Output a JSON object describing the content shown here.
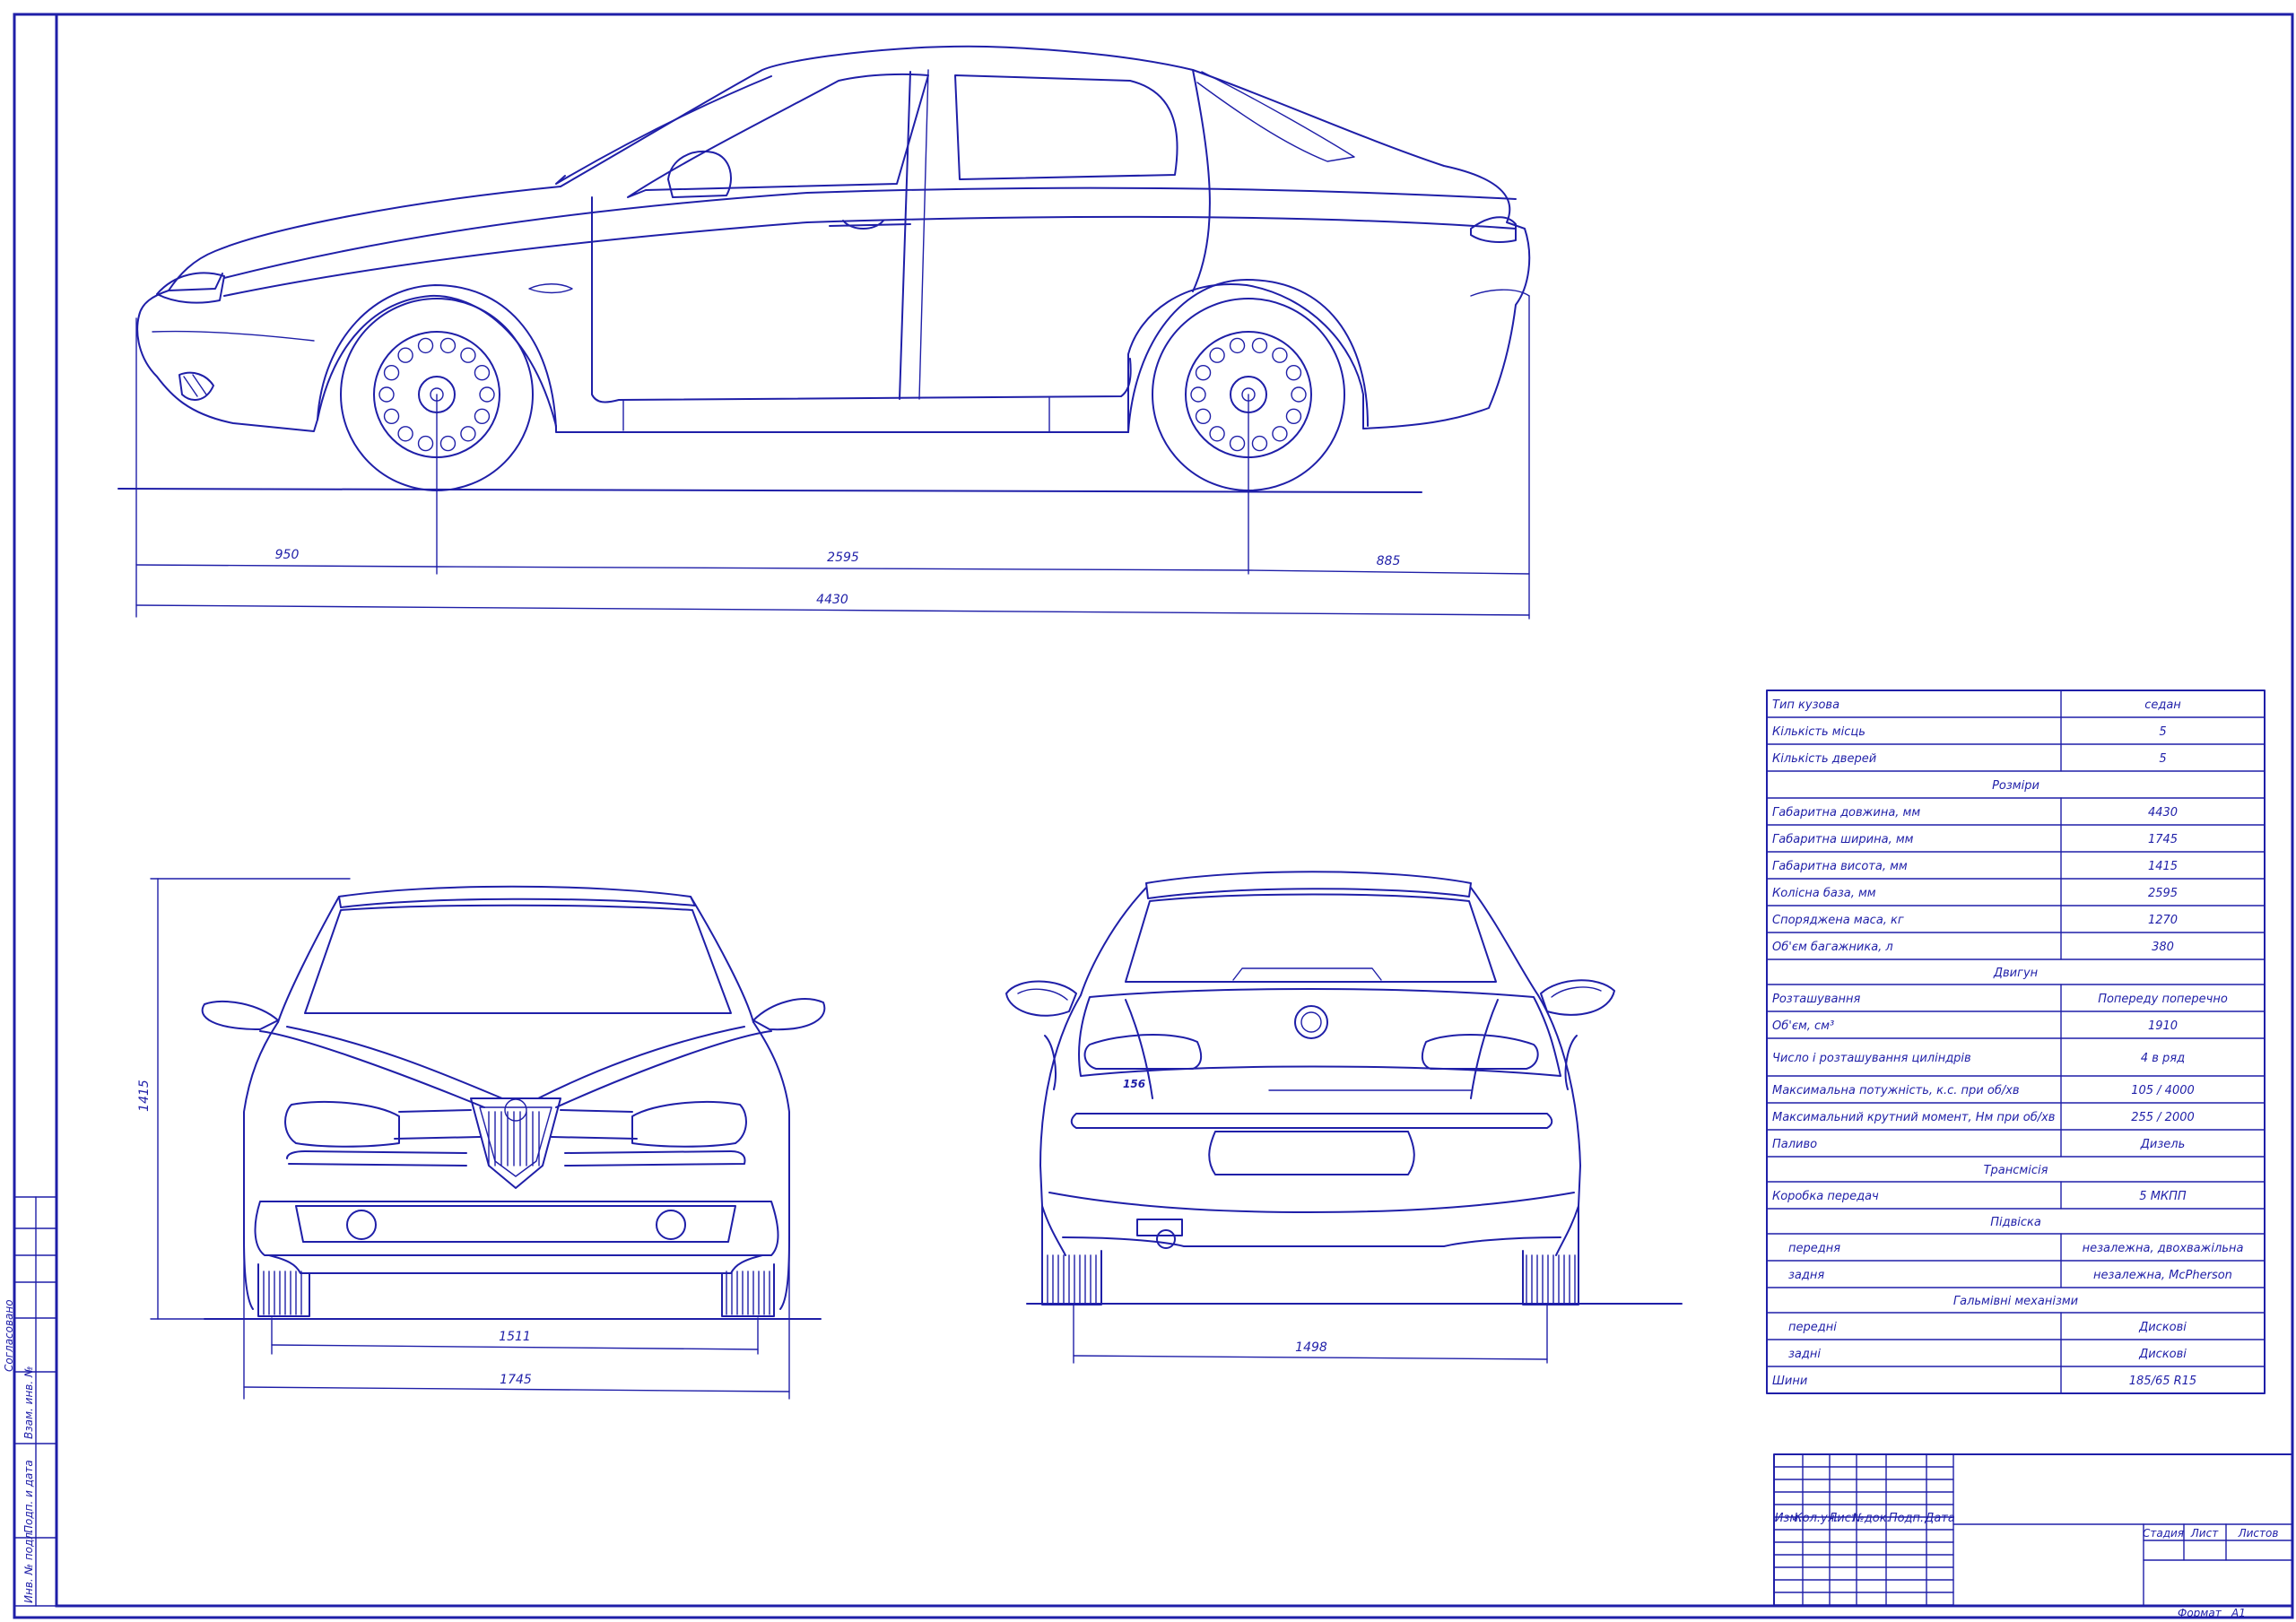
{
  "colors": {
    "ink": "#1f1fa8",
    "paper": "#ffffff"
  },
  "dimensions": {
    "front_overhang": "950",
    "wheelbase": "2595",
    "rear_overhang": "885",
    "overall_length": "4430",
    "height": "1415",
    "front_track": "1511",
    "overall_width": "1745",
    "rear_track": "1498"
  },
  "badges": {
    "model": "156"
  },
  "spec_table": {
    "rows": [
      {
        "kind": "row",
        "label": "Тип кузова",
        "value": "седан"
      },
      {
        "kind": "row",
        "label": "Кількість місць",
        "value": "5"
      },
      {
        "kind": "row",
        "label": "Кількість дверей",
        "value": "5"
      },
      {
        "kind": "section",
        "label": "Розміри"
      },
      {
        "kind": "row",
        "label": "Габаритна довжина, мм",
        "value": "4430"
      },
      {
        "kind": "row",
        "label": "Габаритна ширина, мм",
        "value": "1745"
      },
      {
        "kind": "row",
        "label": "Габаритна висота, мм",
        "value": "1415"
      },
      {
        "kind": "row",
        "label": "Колісна база, мм",
        "value": "2595"
      },
      {
        "kind": "row",
        "label": "Споряджена маса, кг",
        "value": "1270"
      },
      {
        "kind": "row",
        "label": "Об'єм багажника, л",
        "value": "380"
      },
      {
        "kind": "section",
        "label": "Двигун"
      },
      {
        "kind": "row",
        "label": "Розташування",
        "value": "Попереду поперечно"
      },
      {
        "kind": "row",
        "label": "Об'єм, см³",
        "value": "1910"
      },
      {
        "kind": "row",
        "label": "Число і розташування циліндрів",
        "value": "4 в ряд"
      },
      {
        "kind": "row",
        "label": "Максимальна потужність, к.с. при об/хв",
        "value": "105 / 4000"
      },
      {
        "kind": "row",
        "label": "Максимальний крутний момент, Нм при об/хв",
        "value": "255 / 2000"
      },
      {
        "kind": "row",
        "label": "Паливо",
        "value": "Дизель"
      },
      {
        "kind": "section",
        "label": "Трансмісія"
      },
      {
        "kind": "row",
        "label": "Коробка передач",
        "value": "5 МКПП"
      },
      {
        "kind": "section",
        "label": "Підвіска"
      },
      {
        "kind": "row",
        "label": "передня",
        "value": "незалежна, двохважільна",
        "indent": true
      },
      {
        "kind": "row",
        "label": "задня",
        "value": "незалежна, McPherson",
        "indent": true
      },
      {
        "kind": "section",
        "label": "Гальмівні механізми"
      },
      {
        "kind": "row",
        "label": "передні",
        "value": "Дискові",
        "indent": true
      },
      {
        "kind": "row",
        "label": "задні",
        "value": "Дискові",
        "indent": true
      },
      {
        "kind": "row",
        "label": "Шини",
        "value": "185/65 R15"
      }
    ]
  },
  "title_block": {
    "cols": [
      "Изм.",
      "Кол.уч.",
      "Лист",
      "№док.",
      "Подп.",
      "Дата"
    ],
    "stage_labels": [
      "Стадия",
      "Лист",
      "Листов"
    ],
    "format_label": "Формат",
    "format_value": "A1"
  },
  "side_strip": {
    "labels": [
      "Согласовано",
      "Взам. инв. №",
      "Подп. и дата",
      "Инв. № подл."
    ]
  }
}
